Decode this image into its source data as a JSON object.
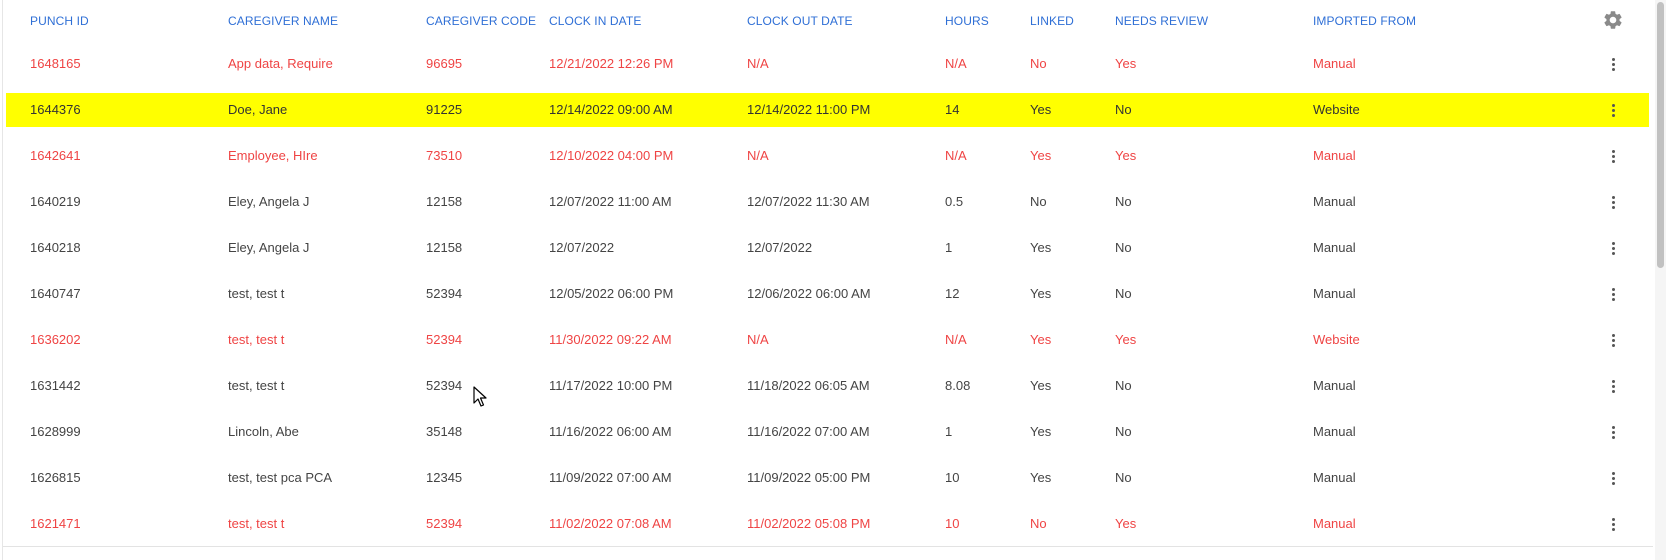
{
  "table": {
    "columns": [
      "PUNCH ID",
      "CAREGIVER NAME",
      "CAREGIVER CODE",
      "CLOCK IN DATE",
      "CLOCK OUT DATE",
      "HOURS",
      "LINKED",
      "NEEDS REVIEW",
      "IMPORTED FROM"
    ],
    "settings_icon": "gear-icon",
    "row_menu_icon": "kebab-menu-icon",
    "colors": {
      "header": "#2f6fd6",
      "flagged": "#ef4444",
      "highlight": "#ffff00",
      "normal": "#444444"
    },
    "rows": [
      {
        "state": "flagged",
        "cells": [
          "1648165",
          "App data, Require",
          "96695",
          "12/21/2022 12:26 PM",
          "N/A",
          "N/A",
          "No",
          "Yes",
          "Manual"
        ]
      },
      {
        "state": "highlight",
        "cells": [
          "1644376",
          "Doe, Jane",
          "91225",
          "12/14/2022 09:00 AM",
          "12/14/2022 11:00 PM",
          "14",
          "Yes",
          "No",
          "Website"
        ]
      },
      {
        "state": "flagged",
        "cells": [
          "1642641",
          "Employee, HIre",
          "73510",
          "12/10/2022 04:00 PM",
          "N/A",
          "N/A",
          "Yes",
          "Yes",
          "Manual"
        ]
      },
      {
        "state": "normal",
        "cells": [
          "1640219",
          "Eley, Angela J",
          "12158",
          "12/07/2022 11:00 AM",
          "12/07/2022 11:30 AM",
          "0.5",
          "No",
          "No",
          "Manual"
        ]
      },
      {
        "state": "normal",
        "cells": [
          "1640218",
          "Eley, Angela J",
          "12158",
          "12/07/2022",
          "12/07/2022",
          "1",
          "Yes",
          "No",
          "Manual"
        ]
      },
      {
        "state": "normal",
        "cells": [
          "1640747",
          "test, test t",
          "52394",
          "12/05/2022 06:00 PM",
          "12/06/2022 06:00 AM",
          "12",
          "Yes",
          "No",
          "Manual"
        ]
      },
      {
        "state": "flagged",
        "cells": [
          "1636202",
          "test, test t",
          "52394",
          "11/30/2022 09:22 AM",
          "N/A",
          "N/A",
          "Yes",
          "Yes",
          "Website"
        ]
      },
      {
        "state": "normal",
        "cells": [
          "1631442",
          "test, test t",
          "52394",
          "11/17/2022 10:00 PM",
          "11/18/2022 06:05 AM",
          "8.08",
          "Yes",
          "No",
          "Manual"
        ]
      },
      {
        "state": "normal",
        "cells": [
          "1628999",
          "Lincoln, Abe",
          "35148",
          "11/16/2022 06:00 AM",
          "11/16/2022 07:00 AM",
          "1",
          "Yes",
          "No",
          "Manual"
        ]
      },
      {
        "state": "normal",
        "cells": [
          "1626815",
          "test, test pca PCA",
          "12345",
          "11/09/2022 07:00 AM",
          "11/09/2022 05:00 PM",
          "10",
          "Yes",
          "No",
          "Manual"
        ]
      },
      {
        "state": "flagged",
        "cells": [
          "1621471",
          "test, test t",
          "52394",
          "11/02/2022 07:08 AM",
          "11/02/2022 05:08 PM",
          "10",
          "No",
          "Yes",
          "Manual"
        ]
      }
    ]
  }
}
